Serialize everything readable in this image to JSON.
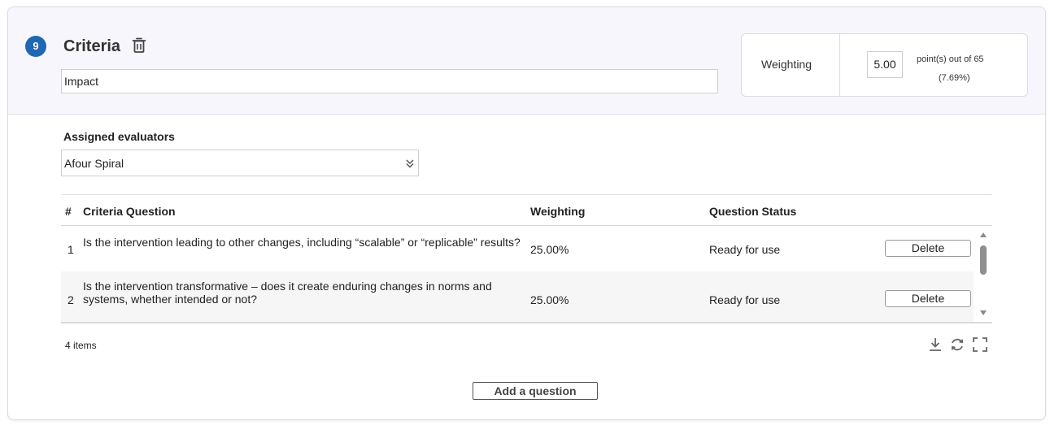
{
  "criteria": {
    "step_number": "9",
    "title": "Criteria",
    "name_value": "Impact"
  },
  "weighting": {
    "label": "Weighting",
    "value": "5.00",
    "points_text": "point(s) out of 65",
    "percent_text": "(7.69%)"
  },
  "evaluators": {
    "label": "Assigned evaluators",
    "selected": "Afour Spiral"
  },
  "table": {
    "headers": {
      "num": "#",
      "question": "Criteria Question",
      "weighting": "Weighting",
      "status": "Question Status"
    },
    "rows": [
      {
        "num": "1",
        "question": "Is the intervention leading to other changes, including “scalable” or “replicable” results?",
        "weighting": "25.00%",
        "status": "Ready for use",
        "action": "Delete"
      },
      {
        "num": "2",
        "question": "Is the intervention transformative – does it create enduring changes in norms and systems, whether intended or not?",
        "weighting": "25.00%",
        "status": "Ready for use",
        "action": "Delete"
      }
    ],
    "items_count": "4 items"
  },
  "actions": {
    "add_question": "Add a question"
  },
  "icons": {
    "trash": "trash-icon",
    "chevron": "double-chevron-down-icon",
    "download": "download-icon",
    "refresh": "refresh-icon",
    "fullscreen": "fullscreen-icon"
  },
  "colors": {
    "badge": "#1f67b3",
    "header_bg": "#f7f6fd"
  }
}
